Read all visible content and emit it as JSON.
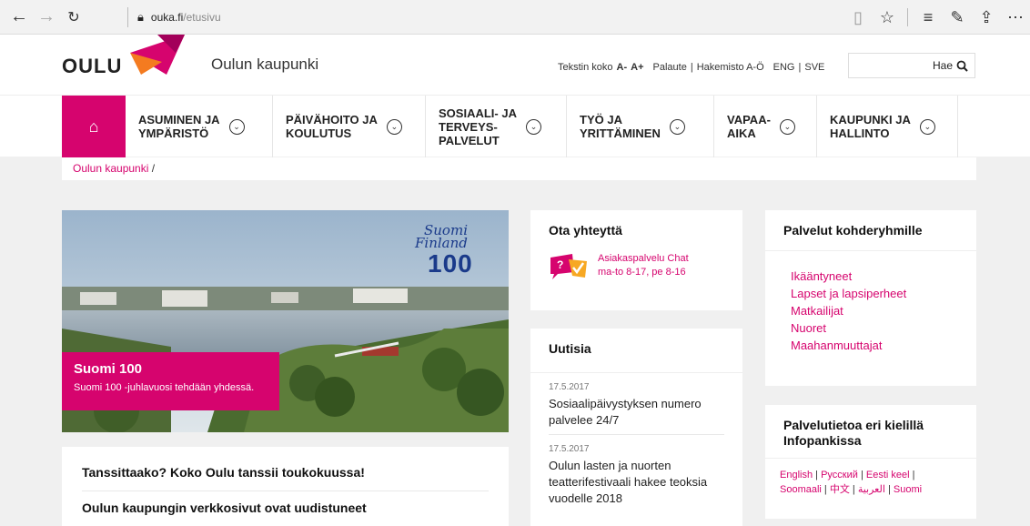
{
  "browser": {
    "url_host": "ouka.fi",
    "url_path": "/etusivu"
  },
  "header": {
    "logo_text": "OULU",
    "site_name": "Oulun kaupunki",
    "text_size_label": "Tekstin koko",
    "text_smaller": "A-",
    "text_larger": "A+",
    "feedback": "Palaute",
    "index": "Hakemisto A-Ö",
    "lang_eng": "ENG",
    "lang_sve": "SVE",
    "search_button": "Hae",
    "search_value": ""
  },
  "nav": {
    "items": [
      {
        "label_1": "ASUMINEN JA",
        "label_2": "YMPÄRISTÖ",
        "label_3": ""
      },
      {
        "label_1": "PÄIVÄHOITO JA",
        "label_2": "KOULUTUS",
        "label_3": ""
      },
      {
        "label_1": "SOSIAALI- JA",
        "label_2": "TERVEYS-",
        "label_3": "PALVELUT"
      },
      {
        "label_1": "TYÖ JA",
        "label_2": "YRITTÄMINEN",
        "label_3": ""
      },
      {
        "label_1": "VAPAA-",
        "label_2": "AIKA",
        "label_3": ""
      },
      {
        "label_1": "KAUPUNKI JA",
        "label_2": "HALLINTO",
        "label_3": ""
      }
    ]
  },
  "breadcrumb": {
    "home": "Oulun kaupunki",
    "sep": "/"
  },
  "hero": {
    "logo_script_1": "Suomi",
    "logo_script_2": "Finland",
    "logo_num": "100",
    "title": "Suomi 100",
    "subtitle": "Suomi 100 -juhlavuosi tehdään yhdessä."
  },
  "news_main": {
    "item1": "Tanssittaako? Koko Oulu tanssii toukokuussa!",
    "item2": "Oulun kaupungin verkkosivut ovat uudistuneet"
  },
  "contact": {
    "title": "Ota yhteyttä",
    "chat_line1": "Asiakaspalvelu Chat",
    "chat_line2": "ma-to 8-17, pe 8-16"
  },
  "news": {
    "title": "Uutisia",
    "items": [
      {
        "date": "17.5.2017",
        "text": "Sosiaalipäivystyksen numero palvelee 24/7"
      },
      {
        "date": "17.5.2017",
        "text": "Oulun lasten ja nuorten teatterifestivaali hakee teoksia vuodelle 2018"
      }
    ]
  },
  "services": {
    "title": "Palvelut kohderyhmille",
    "items": [
      "Ikääntyneet",
      "Lapset ja lapsiperheet",
      "Matkailijat",
      "Nuoret",
      "Maahanmuuttajat"
    ]
  },
  "languages": {
    "title": "Palvelutietoa eri kielillä Infopankissa",
    "items": [
      "English",
      "Русский",
      "Eesti keel",
      "Soomaali",
      "中文",
      "العربية",
      "Suomi"
    ],
    "sep": "|"
  },
  "colors": {
    "accent": "#d6046e"
  }
}
